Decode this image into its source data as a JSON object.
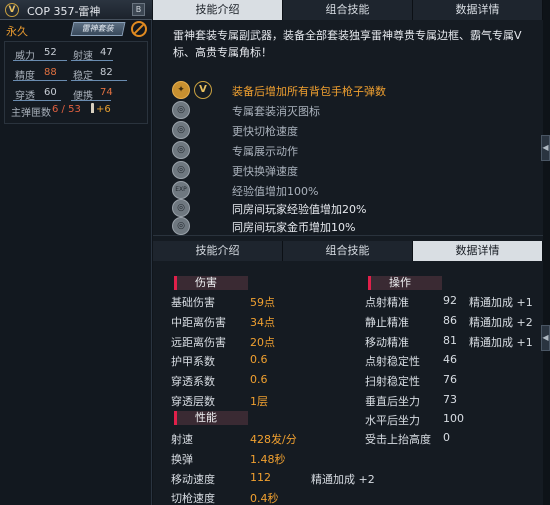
{
  "left": {
    "weapon_name": "COP 357-雷神",
    "badge_v": "V",
    "header_tag": "B",
    "duration": "永久",
    "brand_tag": "雷神套装",
    "stats": [
      {
        "label": "威力",
        "value": "52"
      },
      {
        "label": "射速",
        "value": "47"
      },
      {
        "label": "精度",
        "value": "88"
      },
      {
        "label": "稳定",
        "value": "82"
      },
      {
        "label": "穿透",
        "value": "60"
      },
      {
        "label": "便携",
        "value": "74"
      }
    ],
    "ammo_label": "主弹匣数",
    "ammo_value": "6 / 53",
    "bonus_value": "+6"
  },
  "tabs": [
    "技能介绍",
    "组合技能",
    "数据详情"
  ],
  "skills": {
    "description": "雷神套装专属副武器，装备全部套装独享雷神尊贵专属边框、霸气专属V标、高贵专属角标！",
    "features": [
      {
        "icon": "V",
        "text": "装备后增加所有背包手枪子弹数"
      },
      {
        "icon": "◎",
        "text": "专属套装消灭图标"
      },
      {
        "icon": "◎",
        "text": "更快切枪速度"
      },
      {
        "icon": "◎",
        "text": "专属展示动作"
      },
      {
        "icon": "◎",
        "text": "更快换弹速度"
      },
      {
        "icon": "EXP",
        "text": "经验值增加100%"
      },
      {
        "icon": "◎",
        "text": "同房间玩家经验值增加20%"
      },
      {
        "icon": "◎",
        "text": "同房间玩家金币增加10%"
      }
    ]
  },
  "details": {
    "damage_header": "伤害",
    "damage_rows": [
      {
        "label": "基础伤害",
        "value": "59点"
      },
      {
        "label": "中距离伤害",
        "value": "34点"
      },
      {
        "label": "远距离伤害",
        "value": "20点"
      },
      {
        "label": "护甲系数",
        "value": "0.6"
      },
      {
        "label": "穿透系数",
        "value": "0.6"
      },
      {
        "label": "穿透层数",
        "value": "1层"
      }
    ],
    "performance_header": "性能",
    "performance_rows": [
      {
        "label": "射速",
        "value": "428发/分",
        "bonus": ""
      },
      {
        "label": "换弹",
        "value": "1.48秒",
        "bonus": ""
      },
      {
        "label": "移动速度",
        "value": "112",
        "bonus": "精通加成 +2"
      },
      {
        "label": "切枪速度",
        "value": "0.4秒",
        "bonus": ""
      }
    ],
    "operation_header": "操作",
    "operation_rows": [
      {
        "label": "点射精准",
        "value": "92",
        "bonus": "精通加成 +1"
      },
      {
        "label": "静止精准",
        "value": "86",
        "bonus": "精通加成 +2"
      },
      {
        "label": "移动精准",
        "value": "81",
        "bonus": "精通加成 +1"
      },
      {
        "label": "点射稳定性",
        "value": "46",
        "bonus": ""
      },
      {
        "label": "扫射稳定性",
        "value": "76",
        "bonus": ""
      },
      {
        "label": "垂直后坐力",
        "value": "73",
        "bonus": ""
      },
      {
        "label": "水平后坐力",
        "value": "100",
        "bonus": ""
      },
      {
        "label": "受击上抬高度",
        "value": "0",
        "bonus": ""
      }
    ]
  }
}
